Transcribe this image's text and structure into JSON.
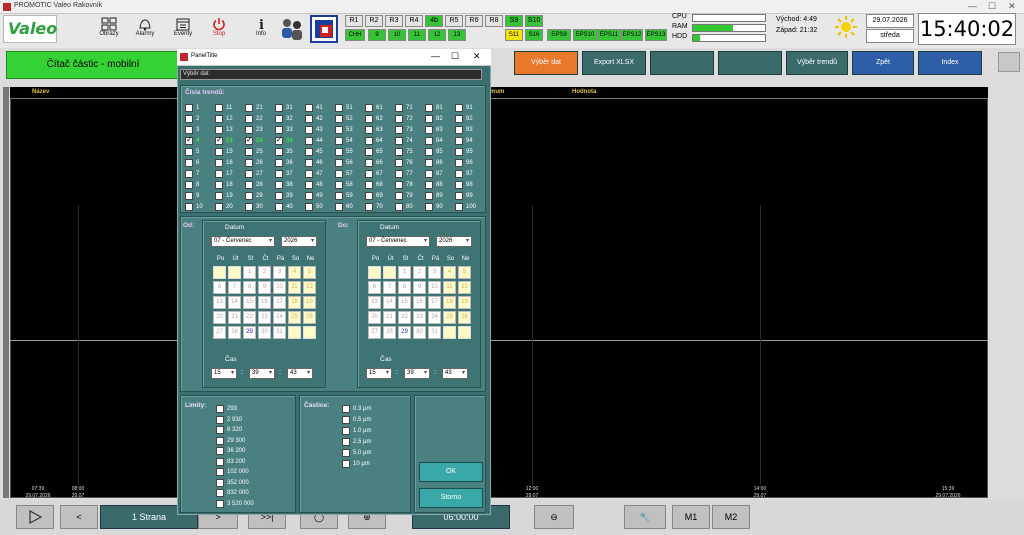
{
  "window_title": "PROMOTIC Valeo Rakovník",
  "brand": "Valeo",
  "toolbar": [
    {
      "label": "Obrazy",
      "icon": "grid-icon"
    },
    {
      "label": "Alarmy",
      "icon": "bell-icon"
    },
    {
      "label": "Eventy",
      "icon": "calendar-icon"
    },
    {
      "label": "Stop",
      "icon": "power-icon"
    },
    {
      "label": "Info",
      "icon": "info-icon"
    }
  ],
  "r_buttons_row1": [
    {
      "t": "R1",
      "c": "n"
    },
    {
      "t": "R2",
      "c": "n"
    },
    {
      "t": "R3",
      "c": "n"
    },
    {
      "t": "R4",
      "c": "n"
    },
    {
      "t": "4b",
      "c": "g"
    },
    {
      "t": "R5",
      "c": "n"
    },
    {
      "t": "R6",
      "c": "n"
    },
    {
      "t": "R8",
      "c": "n"
    },
    {
      "t": "S9",
      "c": "g"
    },
    {
      "t": "S10",
      "c": "g"
    }
  ],
  "r_buttons_row2": [
    {
      "t": "CHH",
      "c": "g"
    },
    {
      "t": "9",
      "c": "g"
    },
    {
      "t": "10",
      "c": "g"
    },
    {
      "t": "11",
      "c": "g"
    },
    {
      "t": "12",
      "c": "g"
    },
    {
      "t": "13",
      "c": "g"
    },
    {
      "t": "S11",
      "c": "y"
    },
    {
      "t": "S16",
      "c": "g"
    },
    {
      "t": "EPS9",
      "c": "g"
    },
    {
      "t": "EPS10",
      "c": "g"
    },
    {
      "t": "EPS11",
      "c": "g"
    },
    {
      "t": "EPS12",
      "c": "g"
    },
    {
      "t": "EPS13",
      "c": "g"
    }
  ],
  "system": {
    "cpu_label": "CPU",
    "ram_label": "RAM",
    "hdd_label": "HDD",
    "cpu": 0.0,
    "ram": 0.55,
    "hdd": 0.1
  },
  "sun": {
    "rise_label": "Východ:",
    "rise": "4:49",
    "set_label": "Západ:",
    "set": "21:32"
  },
  "date": "29.07.2026",
  "day": "středa",
  "clock": "15:40:02",
  "page_title": "Čítač částic - mobilní",
  "nav": [
    "Výběr dat",
    "Export XLSX",
    "",
    "",
    "Výběr trendů",
    "Zpět",
    "Index"
  ],
  "table_headers": {
    "name": "Název",
    "min": "mum",
    "value": "Hodnota"
  },
  "time_ticks": [
    {
      "t": "07:39",
      "d": "29.07.2026"
    },
    {
      "t": "08:00",
      "d": "29.07"
    },
    {
      "t": "12:00",
      "d": "29.07"
    },
    {
      "t": "14:00",
      "d": "29.07"
    },
    {
      "t": "15:39",
      "d": "29.07.2026"
    }
  ],
  "bottom": {
    "page": "1 Strana",
    "time": "06:00:00",
    "m1": "M1",
    "m2": "M2"
  },
  "dialog": {
    "title": "PanelTitle",
    "subtitle": "Výběr dat",
    "trends_label": "Čísla trendů:",
    "trends": [
      [
        1,
        11,
        21,
        31,
        41,
        51,
        61,
        71,
        81,
        91
      ],
      [
        2,
        12,
        22,
        32,
        42,
        52,
        62,
        72,
        82,
        92
      ],
      [
        3,
        13,
        23,
        33,
        43,
        53,
        63,
        73,
        83,
        93
      ],
      [
        4,
        14,
        24,
        34,
        44,
        54,
        64,
        74,
        84,
        94
      ],
      [
        5,
        15,
        25,
        35,
        45,
        55,
        65,
        75,
        85,
        95
      ],
      [
        6,
        16,
        26,
        36,
        46,
        56,
        66,
        76,
        86,
        96
      ],
      [
        7,
        17,
        27,
        37,
        47,
        57,
        67,
        77,
        87,
        97
      ],
      [
        8,
        18,
        28,
        38,
        48,
        58,
        68,
        78,
        88,
        98
      ],
      [
        9,
        19,
        29,
        39,
        49,
        59,
        69,
        79,
        89,
        99
      ],
      [
        10,
        20,
        30,
        40,
        50,
        60,
        70,
        80,
        90,
        100
      ]
    ],
    "checked": [
      4,
      14,
      24,
      34
    ],
    "from_label": "Od:",
    "to_label": "Do:",
    "date_label": "Datum",
    "month": "07 - Červenec",
    "year": "2026",
    "weekdays": [
      "Po",
      "Út",
      "St",
      "Čt",
      "Pá",
      "So",
      "Ne"
    ],
    "time_label": "Čas",
    "hour": "15",
    "minute": "39",
    "second": "43",
    "limits_label": "Limity:",
    "limits": [
      "293",
      "2 930",
      "8 320",
      "29 300",
      "36 200",
      "83 200",
      "102 000",
      "352 000",
      "832 000",
      "3 520 000"
    ],
    "particles_label": "Částice:",
    "particles": [
      "0.3 µm",
      "0.5 µm",
      "1.0 µm",
      "2.5 µm",
      "5.0 µm",
      "10 µm"
    ],
    "ok": "OK",
    "cancel": "Storno"
  }
}
